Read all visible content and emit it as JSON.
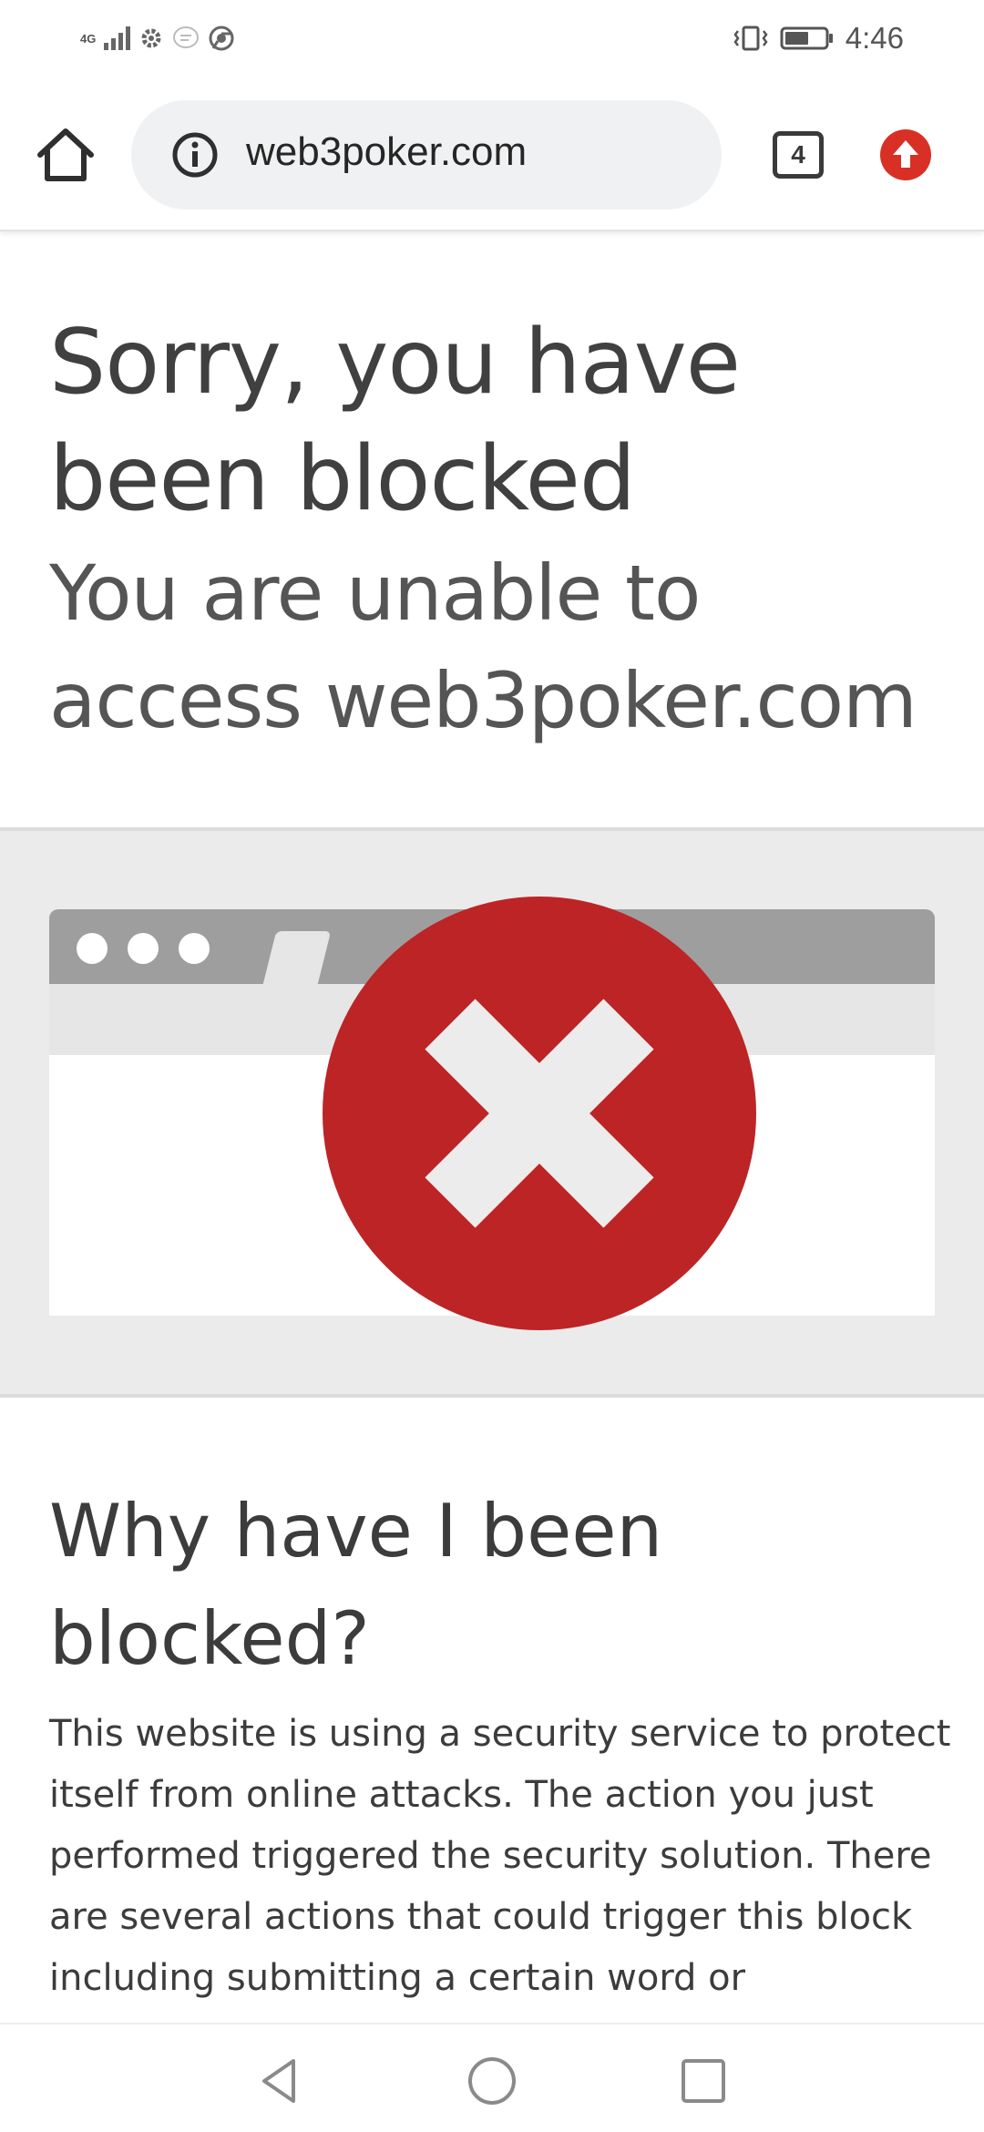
{
  "status_bar": {
    "network": "4G",
    "time": "4:46",
    "icons": [
      "signal-icon",
      "settings-icon",
      "message-icon",
      "chrome-icon",
      "vibrate-icon",
      "battery-icon"
    ],
    "battery_level": 0.6
  },
  "toolbar": {
    "url": "web3poker.com",
    "tab_count": "4",
    "home_icon": "home-icon",
    "info_icon": "info-icon",
    "update_icon": "update-arrow-icon",
    "update_color": "#d93025"
  },
  "page": {
    "headline": "Sorry, you have been blocked",
    "subhead": "You are unable to access web3poker.com",
    "illustration": {
      "icon": "blocked-x-icon",
      "circle_color": "#bd2426"
    },
    "why_heading": "Why have I been blocked?",
    "why_text": "This website is using a security service to protect itself from online attacks. The action you just performed triggered the security solution. There are several actions that could trigger this block including submitting a certain word or"
  },
  "nav_bar": {
    "buttons": [
      "back-icon",
      "home-circle-icon",
      "recents-icon"
    ]
  }
}
